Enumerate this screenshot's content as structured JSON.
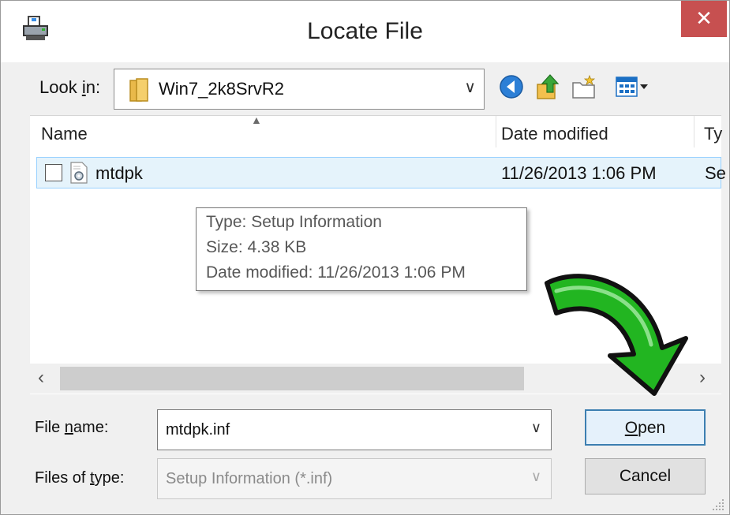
{
  "window": {
    "title": "Locate File",
    "close_glyph": "✕"
  },
  "lookin": {
    "label": "Look in:",
    "value": "Win7_2k8SrvR2",
    "chevron": "∨"
  },
  "toolbar": {
    "icons": [
      "back-icon",
      "up-folder-icon",
      "new-folder-icon",
      "view-menu-icon"
    ]
  },
  "filelist": {
    "columns": [
      "Name",
      "Date modified",
      "Ty"
    ],
    "sort_glyph": "▲",
    "rows": [
      {
        "name": "mtdpk",
        "date": "11/26/2013 1:06 PM",
        "type": "Se"
      }
    ]
  },
  "tooltip": {
    "type": "Type: Setup Information",
    "size": "Size: 4.38 KB",
    "date": "Date modified: 11/26/2013 1:06 PM"
  },
  "scrollbar": {
    "left_glyph": "‹",
    "right_glyph": "›"
  },
  "filename": {
    "label_prefix": "File ",
    "label_accel": "n",
    "label_suffix": "ame:",
    "value": "mtdpk.inf",
    "chevron": "∨"
  },
  "filetype": {
    "label_prefix": "Files of ",
    "label_accel": "t",
    "label_suffix": "ype:",
    "value": "Setup Information (*.inf)",
    "chevron": "∨"
  },
  "buttons": {
    "open_accel": "O",
    "open_rest": "pen",
    "cancel": "Cancel"
  },
  "colors": {
    "accent": "#3c7fb1",
    "close": "#c75050",
    "selection": "#e5f3fb",
    "arrow_green": "#22b521"
  }
}
